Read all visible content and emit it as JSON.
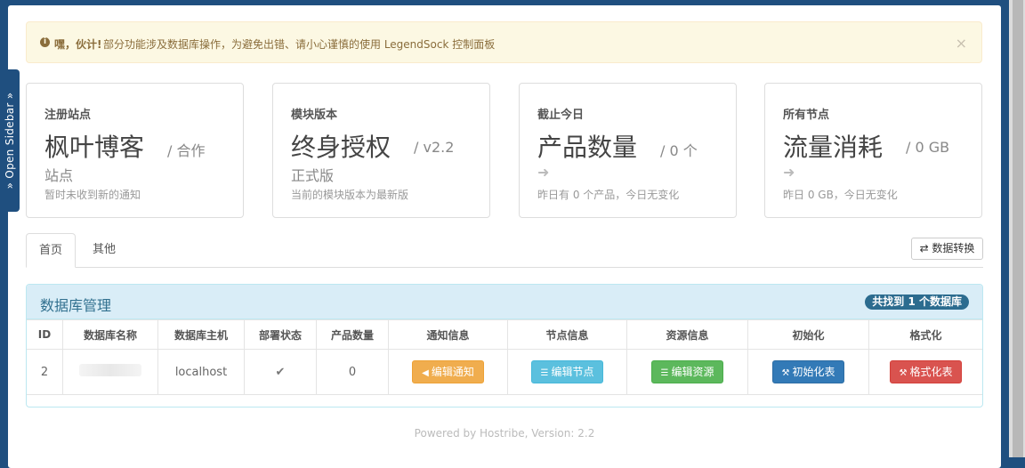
{
  "sidebar_toggle": {
    "label": "» Open Sidebar »"
  },
  "alert": {
    "strong": "嘿，伙计!",
    "message": "部分功能涉及数据库操作，为避免出错、请小心谨慎的使用 LegendSock 控制面板",
    "close": "×"
  },
  "cards": [
    {
      "label": "注册站点",
      "big": "枫叶博客",
      "sub": "/  合作",
      "sub2": "站点",
      "note": "暂时未收到新的通知"
    },
    {
      "label": "模块版本",
      "big": "终身授权",
      "sub": "/  v2.2",
      "sub2": "正式版",
      "note": "当前的模块版本为最新版"
    },
    {
      "label": "截止今日",
      "big": "产品数量",
      "sub": "/  0 个",
      "arrow": "➜",
      "note": "昨日有 0 个产品，今日无变化"
    },
    {
      "label": "所有节点",
      "big": "流量消耗",
      "sub": "/  0 GB",
      "arrow": "➜",
      "note": "昨日 0 GB，今日无变化"
    }
  ],
  "tabs": {
    "home": "首页",
    "other": "其他"
  },
  "convert_button": "⇄ 数据转换",
  "panel": {
    "title": "数据库管理",
    "badge": "共找到 1 个数据库",
    "headers": [
      "ID",
      "数据库名称",
      "数据库主机",
      "部署状态",
      "产品数量",
      "通知信息",
      "节点信息",
      "资源信息",
      "初始化",
      "格式化"
    ],
    "row": {
      "id": "2",
      "host": "localhost",
      "status": "✔",
      "count": "0",
      "btn_notice": "编辑通知",
      "btn_node": "编辑节点",
      "btn_resource": "编辑资源",
      "btn_init": "初始化表",
      "btn_format": "格式化表"
    }
  },
  "footer": "Powered by Hostribe, Version: 2.2",
  "colors": {
    "brand": "#1f4f7f",
    "warning": "#f0ad4e",
    "info": "#5bc0de",
    "success": "#5cb85c",
    "primary": "#337ab7",
    "danger": "#d9534f"
  }
}
